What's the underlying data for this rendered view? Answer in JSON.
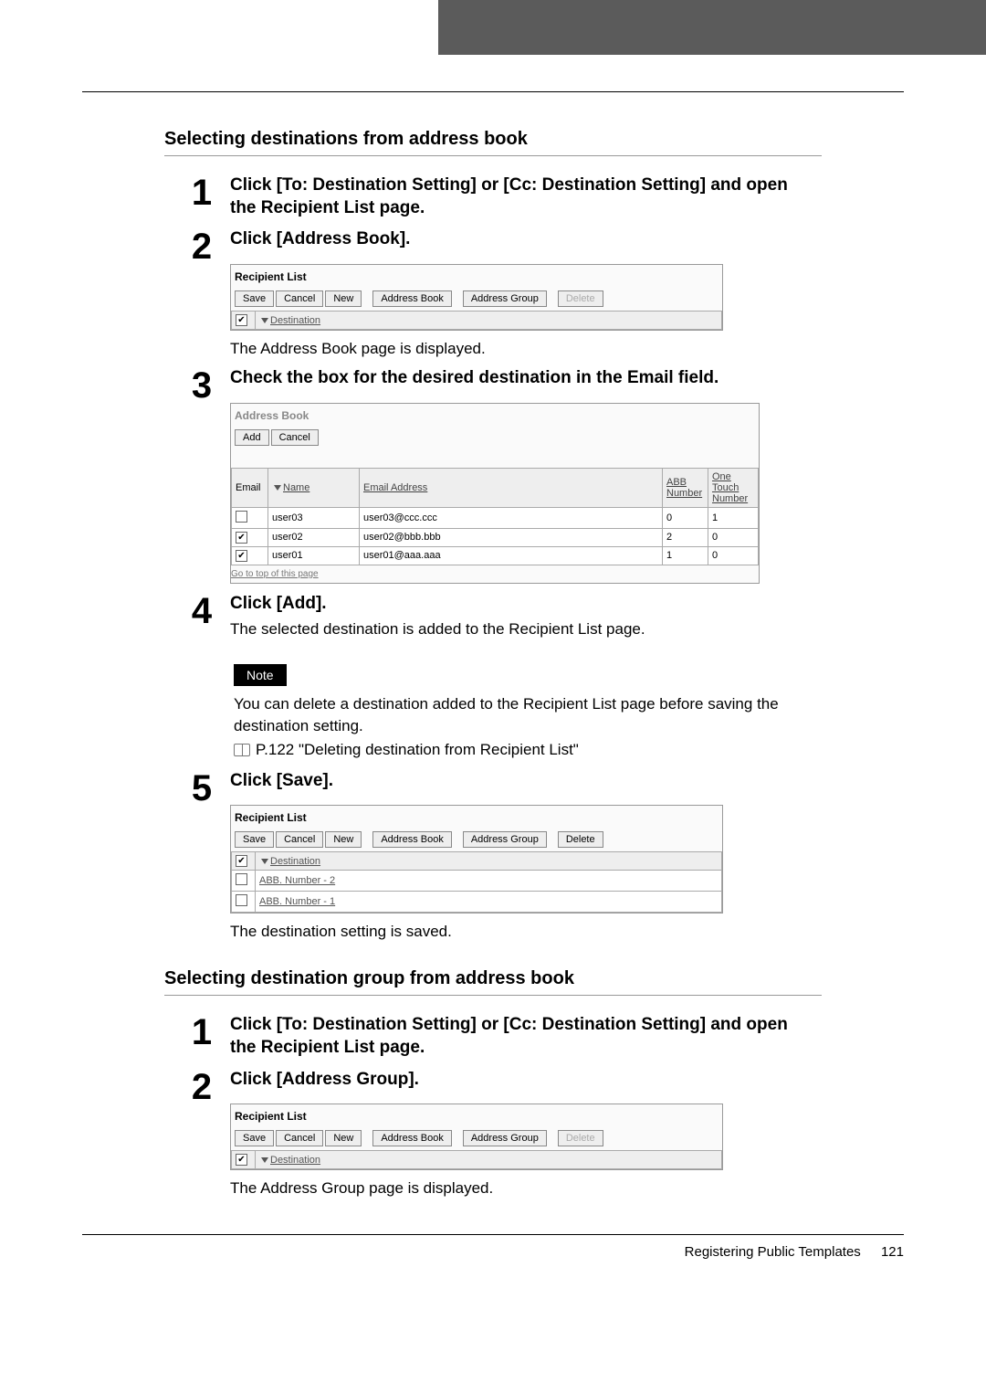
{
  "sections": {
    "s1_title": "Selecting destinations from address book",
    "s2_title": "Selecting destination group from address book"
  },
  "s1_steps": {
    "n1": "1",
    "h1": "Click [To: Destination Setting] or [Cc: Destination Setting] and open the Recipient List page.",
    "n2": "2",
    "h2": "Click [Address Book].",
    "after2": "The Address Book page is displayed.",
    "n3": "3",
    "h3": "Check the box for the desired destination in the Email field.",
    "n4": "4",
    "h4": "Click [Add].",
    "after4a": "The selected destination is added to the Recipient List page.",
    "note_label": "Note",
    "note_text": "You can delete a destination added to the Recipient List page before saving the destination setting.",
    "ref_text": "P.122 \"Deleting destination from Recipient List\"",
    "n5": "5",
    "h5": "Click [Save].",
    "after5": "The destination setting is saved."
  },
  "s2_steps": {
    "n1": "1",
    "h1": "Click [To: Destination Setting] or [Cc: Destination Setting] and open the Recipient List page.",
    "n2": "2",
    "h2": "Click [Address Group].",
    "after2": "The Address Group page is displayed."
  },
  "recipient_list": {
    "title": "Recipient List",
    "btn_save": "Save",
    "btn_cancel": "Cancel",
    "btn_new": "New",
    "btn_addrbook": "Address Book",
    "btn_addrgroup": "Address Group",
    "btn_delete": "Delete",
    "col_dest": "Destination",
    "row1": "ABB. Number - 2",
    "row2": "ABB. Number - 1"
  },
  "address_book": {
    "title": "Address Book",
    "btn_add": "Add",
    "btn_cancel": "Cancel",
    "col_email": "Email",
    "col_name": "Name",
    "col_emailaddr": "Email Address",
    "col_abb": "ABB Number",
    "col_one": "One Touch Number",
    "rows": [
      {
        "checked": false,
        "name": "user03",
        "email": "user03@ccc.ccc",
        "abb": "0",
        "one": "1"
      },
      {
        "checked": true,
        "name": "user02",
        "email": "user02@bbb.bbb",
        "abb": "2",
        "one": "0"
      },
      {
        "checked": true,
        "name": "user01",
        "email": "user01@aaa.aaa",
        "abb": "1",
        "one": "0"
      }
    ],
    "go_top": "Go to top of this page"
  },
  "footer": {
    "title": "Registering Public Templates",
    "page": "121"
  }
}
